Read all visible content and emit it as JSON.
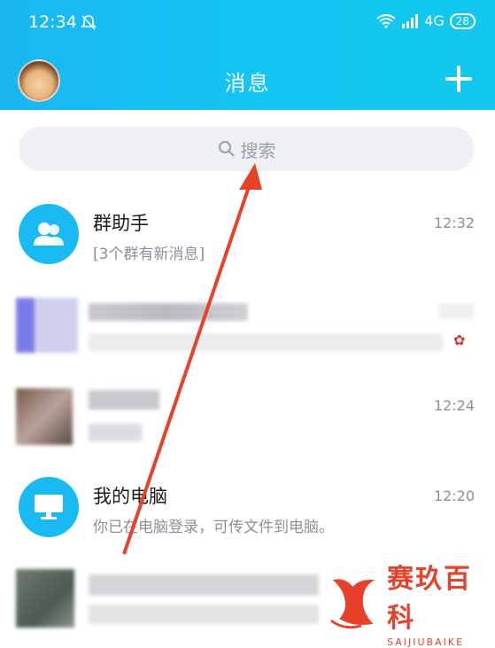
{
  "status_bar": {
    "time": "12:34",
    "network": "4G",
    "battery": "28"
  },
  "header": {
    "title": "消息"
  },
  "search": {
    "placeholder": "搜索"
  },
  "chats": [
    {
      "name": "群助手",
      "preview": "[3个群有新消息]",
      "time": "12:32",
      "icon": "group-icon"
    },
    {
      "name": "",
      "preview": "",
      "time": "",
      "icon": "blurred-avatar"
    },
    {
      "name": "",
      "preview": "",
      "time": "12:24",
      "icon": "blurred-avatar"
    },
    {
      "name": "我的电脑",
      "preview": "你已在电脑登录，可传文件到电脑。",
      "time": "12:20",
      "icon": "monitor-icon"
    },
    {
      "name": "",
      "preview": "",
      "time": "",
      "icon": "blurred-avatar"
    }
  ],
  "watermark": {
    "cn": "赛玖百科",
    "en": "SAIJIUBAIKE"
  },
  "colors": {
    "header": "#1ab7f3",
    "accent_icon": "#19b9f2",
    "arrow": "#e8412a"
  }
}
